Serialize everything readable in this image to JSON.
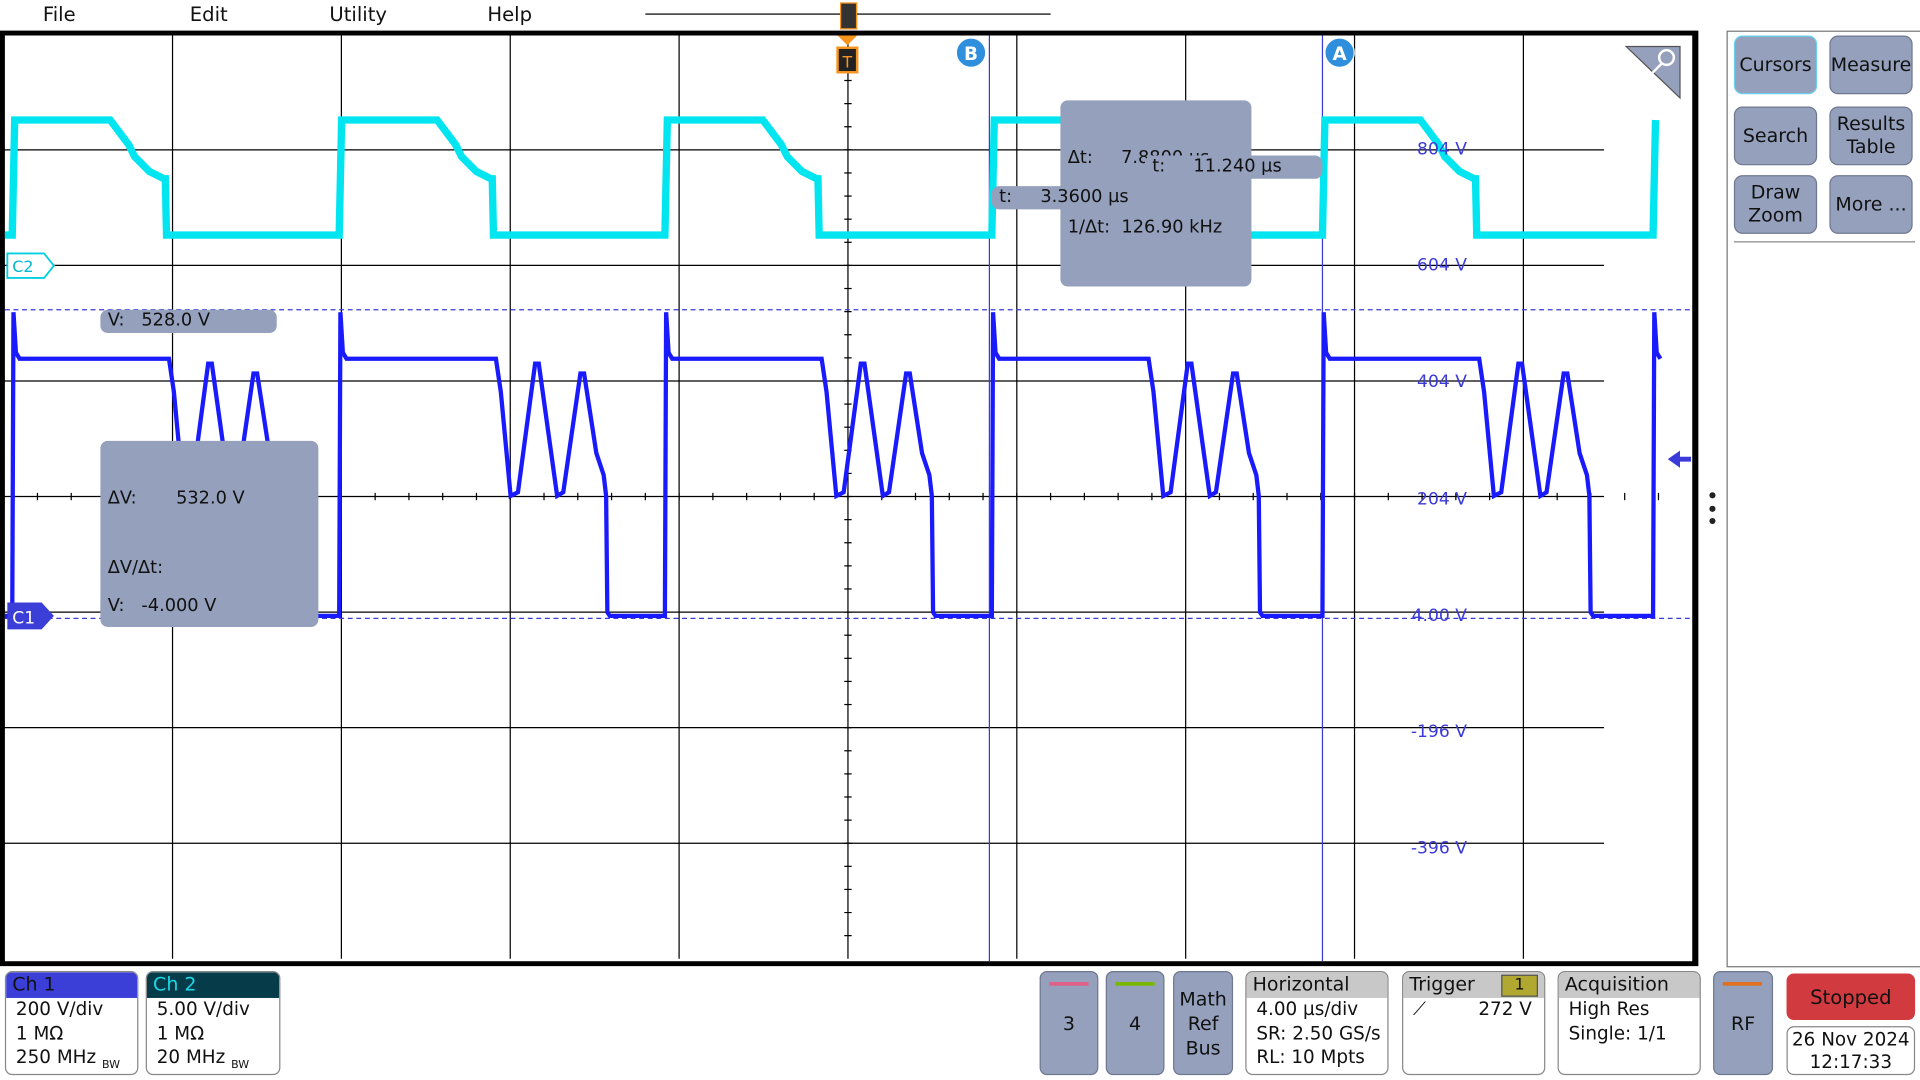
{
  "menu": {
    "items": [
      "File",
      "Edit",
      "Utility",
      "Help"
    ]
  },
  "markers": {
    "trigger": "T",
    "cursor_a": "A",
    "cursor_b": "B"
  },
  "readouts": {
    "delta_t": "Δt:     7.8800 µs",
    "inv_delta_t": "1/Δt:  126.90 kHz",
    "t_a": "t:     11.240 µs",
    "t_b": "t:     3.3600 µs",
    "v_a": "V:   528.0 V",
    "delta_v": "ΔV:       532.0 V",
    "dv_dt": "ΔV/Δt:",
    "v_b": "V:   -4.000 V"
  },
  "channel_markers": {
    "c1": "C1",
    "c2": "C2"
  },
  "vertical_labels": [
    "804 V",
    "604 V",
    "404 V",
    "204 V",
    "4.00 V",
    "-196 V",
    "-396 V"
  ],
  "right_panel": {
    "buttons": [
      "Cursors",
      "Measure",
      "Search",
      "Results Table",
      "Draw Zoom",
      "More ..."
    ]
  },
  "bottom": {
    "ch1": {
      "title": "Ch 1",
      "scale": "200 V/div",
      "impedance": "1 MΩ",
      "bandwidth": "250 MHz",
      "bw_mark": "BW"
    },
    "ch2": {
      "title": "Ch 2",
      "scale": "5.00 V/div",
      "impedance": "1 MΩ",
      "bandwidth": "20 MHz",
      "bw_mark": "BW"
    },
    "ch3": "3",
    "ch4": "4",
    "math": [
      "Math",
      "Ref",
      "Bus"
    ],
    "horizontal": {
      "title": "Horizontal",
      "scale": "4.00 µs/div",
      "sr": "SR: 2.50 GS/s",
      "rl": "RL: 10 Mpts"
    },
    "trigger": {
      "title": "Trigger",
      "source": "1",
      "level": "272 V",
      "slope": "rising"
    },
    "acquisition": {
      "title": "Acquisition",
      "mode": "High Res",
      "count": "Single: 1/1"
    },
    "rf": "RF",
    "status": "Stopped",
    "date": "26 Nov 2024",
    "time": "12:17:33"
  },
  "colors": {
    "ch1": "#1a1aff",
    "ch2": "#00e5f0",
    "ch1_badge": "#3b3fd8",
    "ch2_badge": "#063c4a",
    "stopped": "#d13a3f",
    "trigger": "#f7941d",
    "ch3": "#e0608a",
    "ch4": "#7ab800",
    "rf": "#e07020"
  }
}
